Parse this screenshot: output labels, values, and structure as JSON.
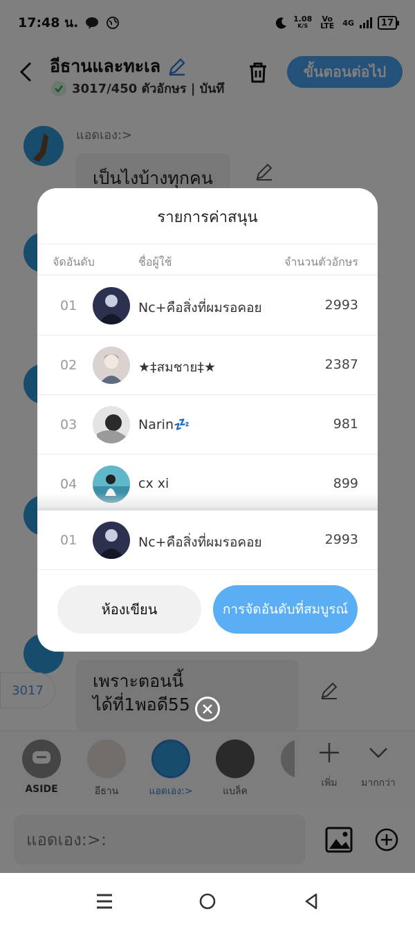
{
  "status_bar": {
    "time": "17:48 น.",
    "net_speed": "1.08",
    "net_unit": "K/S",
    "volte": "Vo LTE",
    "signal": "4G",
    "battery": "17"
  },
  "header": {
    "title": "อีธานและทะเล",
    "subtitle": "3017/450 ตัวอักษร | บันทึ",
    "next_label": "ขั้นตอนต่อไป"
  },
  "chat": {
    "sender_name": "แอดเอง:>",
    "first_message": "เป็นไงบ้างทุกคน",
    "last_message_line1": "เพราะตอนนี้",
    "last_message_line2": "ได้ที่1พอดี55",
    "count_chip": "3017"
  },
  "characters": [
    {
      "label": "ASIDE"
    },
    {
      "label": "อีธาน"
    },
    {
      "label": "แอดเอง:>"
    },
    {
      "label": "แบล็ค"
    }
  ],
  "char_actions": {
    "add_label": "เพิ่ม",
    "more_label": "มากกว่า"
  },
  "input": {
    "placeholder": "แอดเอง:>:"
  },
  "dialog": {
    "title": "รายการค่าสนุน",
    "col_rank": "จัดอันดับ",
    "col_user": "ชื่อผู้ใช้",
    "col_count": "จำนวนตัวอักษร",
    "rows": [
      {
        "rank": "01",
        "name": "Nc+คือสิ่งที่ผมรอคอย",
        "count": "2993"
      },
      {
        "rank": "02",
        "name": "★‡สมชาย‡★",
        "count": "2387"
      },
      {
        "rank": "03",
        "name": "Narin💤",
        "count": "981"
      },
      {
        "rank": "04",
        "name": "cx xi",
        "count": "899"
      }
    ],
    "my_row": {
      "rank": "01",
      "name": "Nc+คือสิ่งที่ผมรอคอย",
      "count": "2993"
    },
    "btn_left": "ห้องเขียน",
    "btn_right": "การจัดอันดับที่สมบูรณ์"
  },
  "colors": {
    "accent": "#4aa4f3",
    "avatar_blue": "#2e98d9"
  }
}
